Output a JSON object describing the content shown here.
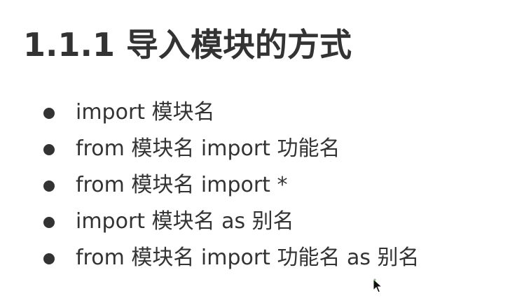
{
  "heading": "1.1.1 导入模块的方式",
  "items": [
    "import 模块名",
    "from 模块名 import 功能名",
    "from 模块名 import *",
    "import 模块名 as 别名",
    "from 模块名 import 功能名 as 别名"
  ],
  "colors": {
    "text": "#333333",
    "background": "#ffffff"
  },
  "icons": {
    "cursor": "mouse-pointer-icon",
    "bullet": "bullet-dot-icon"
  }
}
